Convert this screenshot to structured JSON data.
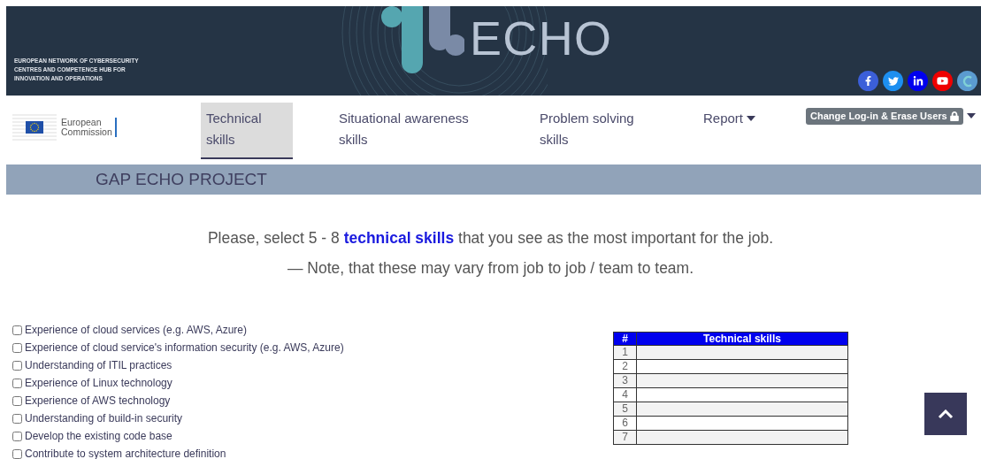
{
  "header": {
    "tagline_lines": [
      "EUROPEAN NETWORK OF CYBERSECURITY",
      "CENTRES AND COMPETENCE HUB FOR",
      "INNOVATION AND OPERATIONS"
    ],
    "logo_text": "ECHO",
    "social": [
      {
        "kind": "facebook",
        "color": "#3b5fd9"
      },
      {
        "kind": "twitter",
        "color": "#1d8ff0"
      },
      {
        "kind": "linkedin",
        "color": "#0000ee"
      },
      {
        "kind": "youtube",
        "color": "#ee0000"
      },
      {
        "kind": "echo",
        "color": "#5b9bd0"
      }
    ]
  },
  "nav": {
    "logo_lines": [
      "European",
      "Commission"
    ],
    "items": [
      {
        "kind": "link",
        "label": "Technical skills",
        "selected": true
      },
      {
        "kind": "link",
        "label": "Situational awareness skills",
        "selected": false
      },
      {
        "kind": "link",
        "label": "Problem solving skills",
        "selected": false
      },
      {
        "kind": "dropdown",
        "label": "Report",
        "selected": false
      },
      {
        "kind": "badge",
        "label": "Change Log-in & Erase Users",
        "selected": false
      }
    ]
  },
  "banner": {
    "title": "GAP ECHO PROJECT"
  },
  "instructions": [
    "Please, select 5 - 8 **technical skills** that you see as the most important for the job.",
    "— Note, that these may vary from job to job / team to team."
  ],
  "skills": [
    {
      "label": "Experience of cloud services (e.g. AWS, Azure)",
      "checked": false
    },
    {
      "label": "Experience of cloud service's information security (e.g. AWS, Azure)",
      "checked": false
    },
    {
      "label": "Understanding of ITIL practices",
      "checked": false
    },
    {
      "label": "Experience of Linux technology",
      "checked": false
    },
    {
      "label": "Experience of AWS technology",
      "checked": false
    },
    {
      "label": "Understanding of build-in security",
      "checked": false
    },
    {
      "label": "Develop the existing code base",
      "checked": false
    },
    {
      "label": "Contribute to system architecture definition",
      "checked": false
    }
  ],
  "table": {
    "columns": [
      "#",
      "Technical skills"
    ],
    "rows": [
      {
        "number": "1"
      },
      {
        "number": "2"
      },
      {
        "number": "3"
      },
      {
        "number": "4"
      },
      {
        "number": "5"
      },
      {
        "number": "6"
      },
      {
        "number": "7"
      }
    ]
  }
}
